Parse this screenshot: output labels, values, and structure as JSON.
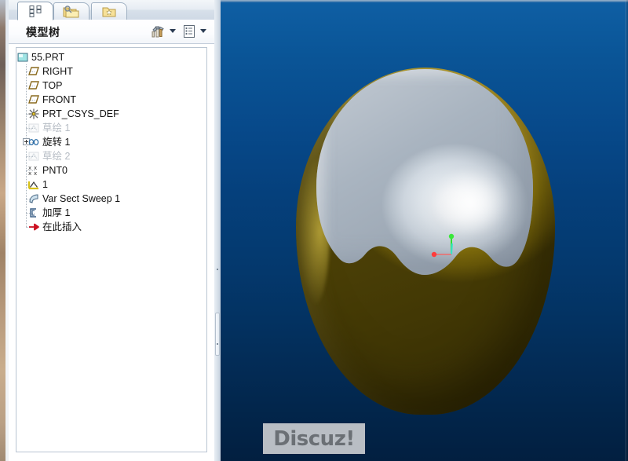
{
  "window": {
    "left_panel": {
      "tabs": [
        {
          "id": "model-tree",
          "icon": "model-tree-icon",
          "active": true
        },
        {
          "id": "folder-browser",
          "icon": "folder-browser-icon",
          "active": false
        },
        {
          "id": "favorites",
          "icon": "favorites-folder-icon",
          "active": false
        }
      ],
      "header": {
        "title": "模型树",
        "buttons": [
          {
            "id": "settings",
            "icon": "tools-settings-icon",
            "has_caret": true
          },
          {
            "id": "display",
            "icon": "list-display-icon",
            "has_caret": true
          }
        ]
      },
      "tree": {
        "items": [
          {
            "label": "55.PRT",
            "icon": "part-icon",
            "depth": 0,
            "dim": false,
            "expander": "none"
          },
          {
            "label": "RIGHT",
            "icon": "datum-plane-icon",
            "depth": 1,
            "dim": false,
            "expander": "none"
          },
          {
            "label": "TOP",
            "icon": "datum-plane-icon",
            "depth": 1,
            "dim": false,
            "expander": "none"
          },
          {
            "label": "FRONT",
            "icon": "datum-plane-icon",
            "depth": 1,
            "dim": false,
            "expander": "none"
          },
          {
            "label": "PRT_CSYS_DEF",
            "icon": "csys-icon",
            "depth": 1,
            "dim": false,
            "expander": "none"
          },
          {
            "label": "草绘 1",
            "icon": "sketch-icon",
            "depth": 1,
            "dim": true,
            "expander": "none"
          },
          {
            "label": "旋转 1",
            "icon": "revolve-icon",
            "depth": 1,
            "dim": false,
            "expander": "plus"
          },
          {
            "label": "草绘 2",
            "icon": "sketch-icon",
            "depth": 1,
            "dim": true,
            "expander": "none"
          },
          {
            "label": "PNT0",
            "icon": "datum-point-icon",
            "depth": 1,
            "dim": false,
            "expander": "none"
          },
          {
            "label": "1",
            "icon": "curve-icon",
            "depth": 1,
            "dim": false,
            "expander": "none"
          },
          {
            "label": "Var Sect Sweep 1",
            "icon": "sweep-icon",
            "depth": 1,
            "dim": false,
            "expander": "none"
          },
          {
            "label": "加厚 1",
            "icon": "thicken-icon",
            "depth": 1,
            "dim": false,
            "expander": "none"
          },
          {
            "label": "在此插入",
            "icon": "insert-here-icon",
            "depth": 1,
            "dim": false,
            "expander": "none"
          }
        ]
      }
    },
    "viewport": {
      "name": "3d-graphics-area",
      "background_top_color": "#0f5fa4",
      "background_bottom_color": "#021f40",
      "model": {
        "body_name": "gold-egg-body",
        "body_color": "#c9ab20",
        "cap_name": "white-dome-cap",
        "cap_color": "#e6ecf2"
      },
      "csys_marker": {
        "name": "coordinate-system-marker",
        "axis_up_color": "#2ee02e",
        "axis_left_color": "#ff3333",
        "axis_mid_color": "#33e0c8"
      },
      "watermark": {
        "text": "Discuz!",
        "color": "#6b7075",
        "background": "#b9bec4"
      }
    }
  }
}
